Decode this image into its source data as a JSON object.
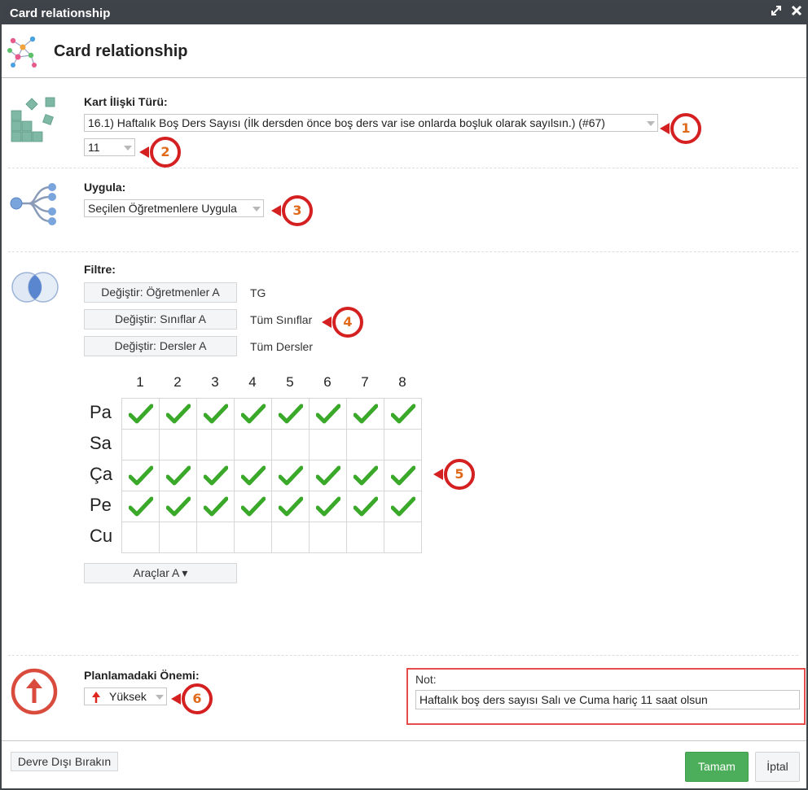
{
  "window": {
    "title": "Card relationship",
    "icons": [
      "expand-icon",
      "close-icon"
    ]
  },
  "header": {
    "heading": "Card relationship",
    "icon": "network-graph-icon"
  },
  "relation_type": {
    "label": "Kart İlişki Türü:",
    "selected": "16.1) Haftalık Boş Ders Sayısı (İlk dersden önce boş ders var ise onlarda boşluk olarak sayılsın.) (#67)",
    "count_selected": "11",
    "icon": "blocks-icon"
  },
  "apply": {
    "label": "Uygula:",
    "selected": "Seçilen Öğretmenlere Uygula",
    "icon": "tree-branches-icon"
  },
  "filter": {
    "label": "Filtre:",
    "icon": "venn-diagram-icon",
    "rows": [
      {
        "button": "Değiştir: Öğretmenler A",
        "value": "TG"
      },
      {
        "button": "Değiştir: Sınıflar A",
        "value": "Tüm Sınıflar"
      },
      {
        "button": "Değiştir: Dersler A",
        "value": "Tüm Dersler"
      }
    ]
  },
  "timetable": {
    "columns": [
      "1",
      "2",
      "3",
      "4",
      "5",
      "6",
      "7",
      "8"
    ],
    "rows": [
      {
        "day": "Pa",
        "checked": [
          true,
          true,
          true,
          true,
          true,
          true,
          true,
          true
        ]
      },
      {
        "day": "Sa",
        "checked": [
          false,
          false,
          false,
          false,
          false,
          false,
          false,
          false
        ]
      },
      {
        "day": "Ça",
        "checked": [
          true,
          true,
          true,
          true,
          true,
          true,
          true,
          true
        ]
      },
      {
        "day": "Pe",
        "checked": [
          true,
          true,
          true,
          true,
          true,
          true,
          true,
          true
        ]
      },
      {
        "day": "Cu",
        "checked": [
          false,
          false,
          false,
          false,
          false,
          false,
          false,
          false
        ]
      }
    ],
    "check_color": "#3aa829"
  },
  "tools": {
    "label": "Araçlar A ▾"
  },
  "importance": {
    "label": "Planlamadaki Önemi:",
    "selected": "Yüksek",
    "icon": "arrow-up-circle-icon",
    "color": "#e03a2f"
  },
  "note": {
    "label": "Not:",
    "value": "Haftalık boş ders sayısı Salı ve Cuma hariç 11 saat olsun"
  },
  "callouts": [
    "1",
    "2",
    "3",
    "4",
    "5",
    "6"
  ],
  "footer": {
    "disable": "Devre Dışı Bırakın",
    "ok": "Tamam",
    "cancel": "İptal",
    "ok_color": "#4cae5a"
  }
}
